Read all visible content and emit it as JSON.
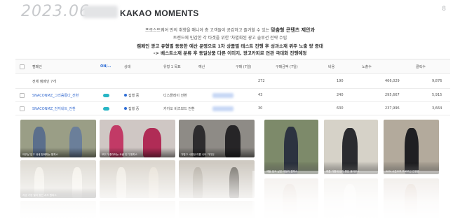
{
  "header": {
    "year": "2023.06",
    "title": "KAKAO MOMENTS",
    "page_number": "8"
  },
  "description": {
    "line1": "프로스트웨어 만의 취향을 매니아 층 고객들이 공감하고 즐거할 수 있는",
    "line1_bold": "맞춤형 콘텐츠 제안과",
    "line2": "트렌드에 민감한 각 타겟을 위한 '차별화된 광고 솔루션 전략 수립",
    "line3": "캠페인 광고 유형별 동등한 예산 운영으로 1차 상품별 테스트 진행 후 성과소재 위주 노출 량 증대",
    "line4": "-> 베스트소재 분류 후 동일상품 다른 이미지, 광고카피로 연관 극대화 진행예정"
  },
  "table": {
    "headers": [
      "캠페인",
      "ON/…",
      "상태",
      "유형 1 목표",
      "예산",
      "구매 (7일)",
      "구매금액 (7일)",
      "비용",
      "노출수",
      "클릭수"
    ],
    "total_row": {
      "label": "전체 캠페인 7개",
      "purchase": "272",
      "cost": "190",
      "impressions": "466,029",
      "clicks": "9,876"
    },
    "rows": [
      {
        "name": "SNACONMZ_그리움통다_전환",
        "status": "집행 중",
        "type": "디스플레이 전환",
        "purchase": "43",
        "cost": "240",
        "impressions": "295,667",
        "clicks": "5,915"
      },
      {
        "name": "SNACONMZ_전지네트_전환",
        "status": "집행 중",
        "type": "카카오 비즈보드 전환",
        "purchase": "30",
        "cost": "630",
        "impressions": "237,996",
        "clicks": "3,664"
      }
    ]
  },
  "photos": {
    "captions": [
      "아무날 입고 내내 함께하는 원피스",
      "모두가 좋아하는 요즘 인기 원피스",
      "가볍고 시원한 여름 니트 가디건",
      "지금 가장 많이 찾는 셔츠 원피스",
      "매일 입고 싶은 데일리 원피스",
      "여름 가볍게 입기 좋은 블라우스",
      "20% 시즌오프 프로모션 진행중"
    ]
  }
}
